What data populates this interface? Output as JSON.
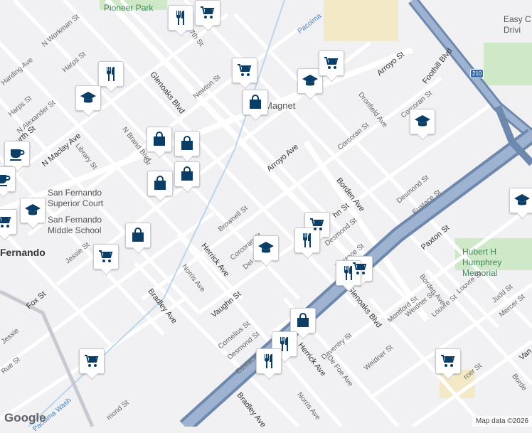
{
  "attribution": "Map data ©2026",
  "logo": "Google",
  "highway_shield": "210",
  "places": [
    {
      "key": "pioneer-park",
      "label": "Pioneer Park",
      "kind": "park"
    },
    {
      "key": "pacoima-top",
      "label": "Pacoima",
      "kind": "water"
    },
    {
      "key": "easy-drive",
      "label": "Easy C Drivi",
      "kind": "place"
    },
    {
      "key": "magnet",
      "label": "Magnet",
      "kind": "place"
    },
    {
      "key": "courthouse",
      "label": "San Fernando Superior Court",
      "kind": "place"
    },
    {
      "key": "middle-school",
      "label": "San Fernando Middle School",
      "kind": "place"
    },
    {
      "key": "city",
      "label": "Fernando",
      "kind": "city"
    },
    {
      "key": "hubert",
      "label": "Hubert H Humphrey Memorial",
      "kind": "park"
    },
    {
      "key": "pacoima-wash",
      "label": "Pacoima Wash",
      "kind": "water"
    }
  ],
  "streets": [
    "N Workman St",
    "Harps St",
    "Harding Ave",
    "Harps St",
    "N Alexander St",
    "Fourth St",
    "N Maclay Ave",
    "Library St",
    "N Brand Blvd",
    "Glenoaks Blvd",
    "Newton St",
    "7th St",
    "Arroyo Ave",
    "Arroyo St",
    "Foothill Blvd",
    "Dronfield Ave",
    "Corcoran St",
    "Corcoran St",
    "Borden Ave",
    "Desmond St",
    "Eustace St",
    "Brownell St",
    "Corcoran St",
    "Herrick Ave",
    "Del",
    "Desmond St",
    "Eustace St",
    "Paxton St",
    "Norris Ave",
    "Bradley Ave",
    "Vaughn St",
    "Cornelius St",
    "Desmond St",
    "Eustace St",
    "Herrick Ave",
    "Daventry St",
    "De Foe Ave",
    "Weidner St",
    "Glenoaks Blvd",
    "Montford St",
    "Borden Ave",
    "Louvre St",
    "Weidner St",
    "Louvre St",
    "Judd St",
    "Mercer St",
    "Jessie St",
    "Fox St",
    "Bradley Ave",
    "Norris Ave",
    "Jessie",
    "Rue St",
    "mond St",
    "hn St",
    "Gr",
    "rcer St",
    "Borde",
    "Van"
  ],
  "markers": [
    {
      "key": "restaurant-top",
      "type": "restaurant"
    },
    {
      "key": "grocery-top",
      "type": "grocery"
    },
    {
      "key": "grocery-newton",
      "type": "grocery"
    },
    {
      "key": "school-magnet",
      "type": "school"
    },
    {
      "key": "grocery-magnet",
      "type": "grocery"
    },
    {
      "key": "restaurant-harps",
      "type": "restaurant"
    },
    {
      "key": "school-alexander",
      "type": "school"
    },
    {
      "key": "shop-brand-1",
      "type": "shopping"
    },
    {
      "key": "shop-brand-2",
      "type": "shopping"
    },
    {
      "key": "shop-glenoaks",
      "type": "shopping"
    },
    {
      "key": "shop-brand-3",
      "type": "shopping"
    },
    {
      "key": "shop-glenoaks-2",
      "type": "shopping"
    },
    {
      "key": "cafe-left",
      "type": "cafe"
    },
    {
      "key": "cafe-edge",
      "type": "cafe"
    },
    {
      "key": "school-court",
      "type": "school"
    },
    {
      "key": "grocery-left",
      "type": "grocery"
    },
    {
      "key": "shop-jessie",
      "type": "shopping"
    },
    {
      "key": "grocery-jessie",
      "type": "grocery"
    },
    {
      "key": "school-corcoran",
      "type": "school"
    },
    {
      "key": "grocery-desmond",
      "type": "grocery"
    },
    {
      "key": "restaurant-desmond",
      "type": "restaurant"
    },
    {
      "key": "school-dronfield",
      "type": "school"
    },
    {
      "key": "school-right",
      "type": "school"
    },
    {
      "key": "grocery-eustace",
      "type": "grocery"
    },
    {
      "key": "restaurant-eustace",
      "type": "restaurant"
    },
    {
      "key": "shop-herrick",
      "type": "shopping"
    },
    {
      "key": "restaurant-herrick-1",
      "type": "restaurant"
    },
    {
      "key": "restaurant-herrick-2",
      "type": "restaurant"
    },
    {
      "key": "grocery-fox",
      "type": "grocery"
    },
    {
      "key": "grocery-mercer",
      "type": "grocery"
    }
  ]
}
